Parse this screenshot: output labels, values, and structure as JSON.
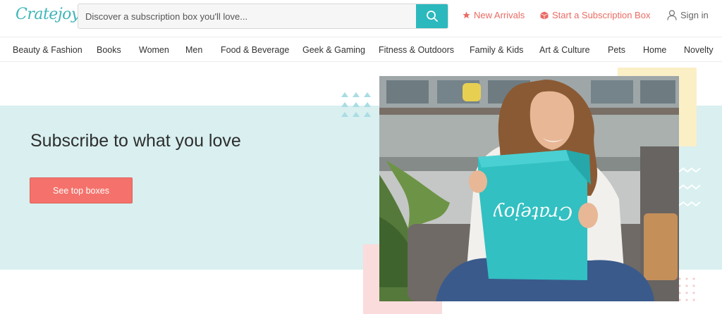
{
  "header": {
    "logo_text": "Cratejoy",
    "search_placeholder": "Discover a subscription box you'll love...",
    "links": {
      "new_arrivals": "New Arrivals",
      "start_box": "Start a Subscription Box",
      "sign_in": "Sign in"
    }
  },
  "categories": [
    "Beauty & Fashion",
    "Books",
    "Women",
    "Men",
    "Food & Beverage",
    "Geek & Gaming",
    "Fitness & Outdoors",
    "Family & Kids",
    "Art & Culture",
    "Pets",
    "Home",
    "Novelty"
  ],
  "hero": {
    "title": "Subscribe to what you love",
    "cta_label": "See top boxes",
    "box_brand": "Cratejoy"
  },
  "colors": {
    "accent_teal": "#2bb9be",
    "accent_coral": "#f4726b",
    "hero_band": "#d9eff0"
  }
}
